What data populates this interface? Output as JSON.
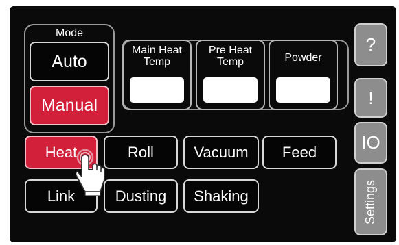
{
  "mode": {
    "title": "Mode",
    "options": [
      {
        "label": "Auto",
        "active": false
      },
      {
        "label": "Manual",
        "active": true
      }
    ]
  },
  "temps": [
    {
      "label": "Main Heat Temp",
      "value": ""
    },
    {
      "label": "Pre Heat Temp",
      "value": ""
    },
    {
      "label": "Powder",
      "value": ""
    }
  ],
  "functions": {
    "row1": [
      {
        "label": "Heat",
        "active": true
      },
      {
        "label": "Roll",
        "active": false
      },
      {
        "label": "Vacuum",
        "active": false
      },
      {
        "label": "Feed",
        "active": false
      }
    ],
    "row2": [
      {
        "label": "Link",
        "active": false
      },
      {
        "label": "Dusting",
        "active": false
      },
      {
        "label": "Shaking",
        "active": false
      }
    ]
  },
  "side_buttons": {
    "help": "?",
    "alert": "!",
    "io": "IO",
    "settings": "Settings"
  },
  "colors": {
    "active": "#d21f3a",
    "side_button": "#8d8d8d",
    "screen_bg": "#0a0a0a"
  },
  "icons": {
    "pointer": "hand-pointer-icon"
  }
}
